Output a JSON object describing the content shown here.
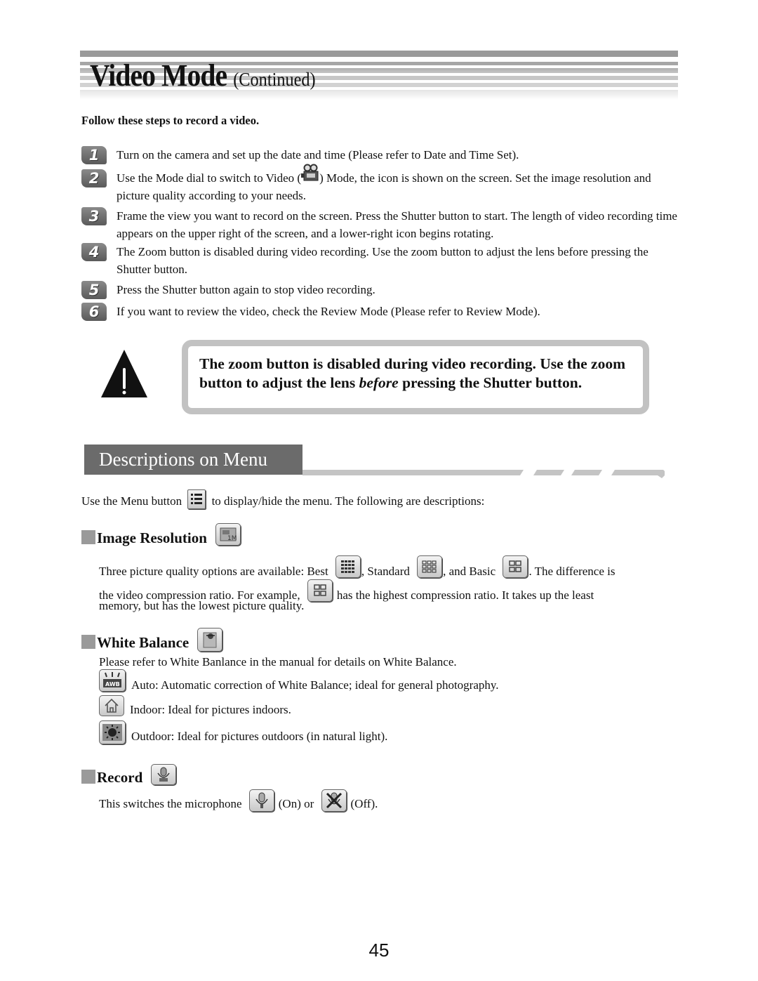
{
  "header": {
    "title": "Video Mode",
    "subtitle": "(Continued)"
  },
  "intro": "Follow these steps to record a video.",
  "steps": [
    {
      "num": "1",
      "text": "Turn on the camera and set up the date and time (Please refer to Date and Time Set)."
    },
    {
      "num": "2",
      "text_before": "Use the Mode dial to switch to Video (",
      "icon": "video-camera-icon",
      "text_after": ") Mode, the icon is shown on the screen. Set the image resolution and picture quality according to your needs."
    },
    {
      "num": "3",
      "text": "Frame the view you want to record on the screen. Press the Shutter button to start. The length of video recording time appears on the upper right of the screen, and a lower-right icon begins rotating."
    },
    {
      "num": "4",
      "text": "The Zoom button is disabled during video recording. Use the zoom button to adjust the lens before pressing the Shutter button."
    },
    {
      "num": "5",
      "text": "Press the Shutter button again to stop video recording."
    },
    {
      "num": "6",
      "text": "If you want to review the video, check the Review Mode (Please refer to Review Mode)."
    }
  ],
  "warning": {
    "icon": "warning-triangle-icon",
    "text_1": "The zoom button is disabled during video recording. Use the zoom button to adjust the lens ",
    "emphasis": "before",
    "text_2": " pressing the Shutter button."
  },
  "section": {
    "title": "Descriptions on Menu",
    "menu_text_before": "Use the Menu button",
    "menu_icon": "menu-list-icon",
    "menu_text_after": "to display/hide the menu. The following are descriptions:"
  },
  "image_resolution": {
    "heading": "Image Resolution",
    "icon": "image-resolution-icon",
    "line1_a": "Three picture quality options are available: Best",
    "line1_b": ", Standard",
    "line1_c": ", and Basic",
    "line1_d": ". The difference is",
    "line2_a": "the video compression ratio. For example,",
    "line2_b": "has the highest compression ratio. It takes up the least",
    "line3": "memory, but has the lowest picture quality."
  },
  "white_balance": {
    "heading": "White Balance",
    "icon": "white-balance-icon",
    "intro": "Please refer to White Banlance in the manual for details on White Balance.",
    "options": [
      {
        "icon": "wb-auto-icon",
        "text": "Auto: Automatic correction of White Balance; ideal for general photography."
      },
      {
        "icon": "wb-indoor-icon",
        "text": "Indoor: Ideal for pictures indoors."
      },
      {
        "icon": "wb-outdoor-icon",
        "text": "Outdoor: Ideal for pictures outdoors (in natural light)."
      }
    ]
  },
  "record": {
    "heading": "Record",
    "icon": "microphone-icon",
    "text_a": "This switches the microphone",
    "text_b": "(On) or",
    "text_c": "(Off)."
  },
  "page_number": "45"
}
